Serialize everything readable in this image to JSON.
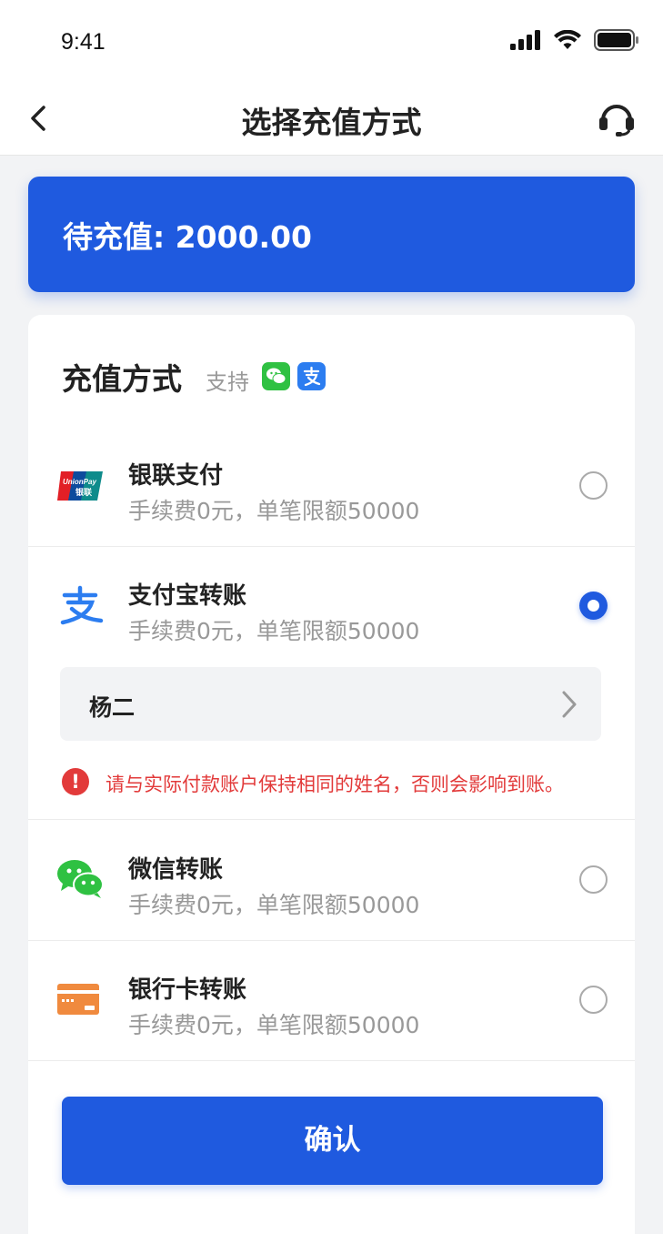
{
  "status_bar": {
    "time": "9:41"
  },
  "nav": {
    "title": "选择充值方式"
  },
  "amount": {
    "label": "待充值: 2000.00"
  },
  "methods_section": {
    "title": "充值方式",
    "support_label": "支持",
    "support_icons": [
      "wechat-icon",
      "alipay-icon"
    ],
    "items": [
      {
        "name": "银联支付",
        "desc": "手续费0元，单笔限额50000",
        "icon": "unionpay-icon",
        "selected": false
      },
      {
        "name": "支付宝转账",
        "desc": "手续费0元，单笔限额50000",
        "icon": "alipay-icon",
        "selected": true
      },
      {
        "name": "微信转账",
        "desc": "手续费0元，单笔限额50000",
        "icon": "wechat-icon",
        "selected": false
      },
      {
        "name": "银行卡转账",
        "desc": "手续费0元，单笔限额50000",
        "icon": "bank-card-icon",
        "selected": false
      }
    ],
    "payer_name": "杨二",
    "warning": "请与实际付款账户保持相同的姓名，否则会影响到账。"
  },
  "confirm_button": {
    "label": "确认"
  },
  "colors": {
    "primary": "#1f5adf",
    "warning": "#e23a3a",
    "wechat": "#2fc142",
    "alipay": "#2c7df0",
    "bank_card": "#f08a3e"
  }
}
